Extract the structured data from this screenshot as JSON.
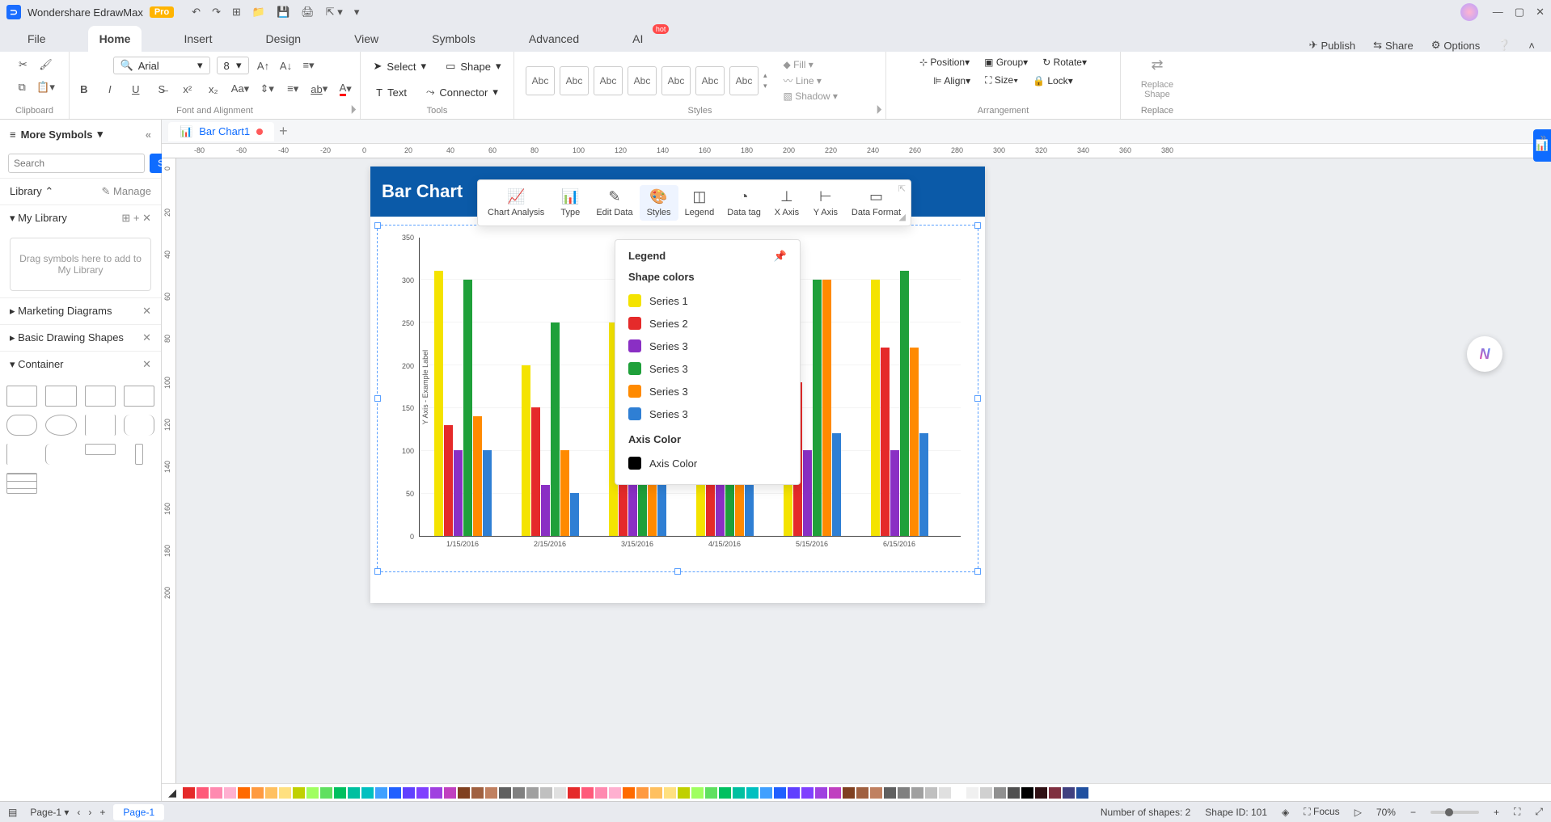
{
  "app": {
    "name": "Wondershare EdrawMax",
    "pro": "Pro"
  },
  "menu": {
    "tabs": [
      "File",
      "Home",
      "Insert",
      "Design",
      "View",
      "Symbols",
      "Advanced",
      "AI"
    ],
    "active": 1,
    "hot": "hot",
    "right": {
      "publish": "Publish",
      "share": "Share",
      "options": "Options"
    }
  },
  "ribbon": {
    "clipboard": "Clipboard",
    "font": {
      "label": "Font and Alignment",
      "name": "Arial",
      "size": "8"
    },
    "tools": {
      "label": "Tools",
      "select": "Select",
      "shape": "Shape",
      "text": "Text",
      "connector": "Connector"
    },
    "styles": {
      "label": "Styles",
      "abc": "Abc",
      "fill": "Fill",
      "line": "Line",
      "shadow": "Shadow"
    },
    "arrange": {
      "label": "Arrangement",
      "position": "Position",
      "align": "Align",
      "group": "Group",
      "size": "Size",
      "rotate": "Rotate",
      "lock": "Lock"
    },
    "replace": {
      "label": "Replace",
      "btn": "Replace Shape"
    }
  },
  "left": {
    "title": "More Symbols",
    "search_ph": "Search",
    "search_btn": "Search",
    "library": "Library",
    "manage": "Manage",
    "mylib": "My Library",
    "dropzone": "Drag symbols here to add to My Library",
    "cats": [
      "Marketing Diagrams",
      "Basic Drawing Shapes",
      "Container"
    ]
  },
  "doc": {
    "tab": "Bar Chart1"
  },
  "ruler_h": [
    "-80",
    "-60",
    "-40",
    "-20",
    "0",
    "20",
    "40",
    "60",
    "80",
    "100",
    "120",
    "140",
    "160",
    "180",
    "200",
    "220",
    "240",
    "260",
    "280",
    "300",
    "320",
    "340",
    "360",
    "380"
  ],
  "ruler_v": [
    "0",
    "20",
    "40",
    "60",
    "80",
    "100",
    "120",
    "140",
    "160",
    "180",
    "200"
  ],
  "chart_data": {
    "type": "bar",
    "title": "Bar Chart",
    "ylabel": "Y Axis - Example Label",
    "ylim": [
      0,
      350
    ],
    "yticks": [
      0,
      50,
      100,
      150,
      200,
      250,
      300,
      350
    ],
    "categories": [
      "1/15/2016",
      "2/15/2016",
      "3/15/2016",
      "4/15/2016",
      "5/15/2016",
      "6/15/2016"
    ],
    "series": [
      {
        "name": "Series 1",
        "color": "#f4e300",
        "values": [
          310,
          200,
          250,
          280,
          300,
          300
        ]
      },
      {
        "name": "Series 2",
        "color": "#e52a2a",
        "values": [
          130,
          150,
          180,
          200,
          180,
          220
        ]
      },
      {
        "name": "Series 3",
        "color": "#8a2fc4",
        "values": [
          100,
          60,
          90,
          150,
          100,
          100
        ]
      },
      {
        "name": "Series 3",
        "color": "#1fa03a",
        "values": [
          300,
          250,
          280,
          300,
          300,
          310
        ]
      },
      {
        "name": "Series 3",
        "color": "#ff8a00",
        "values": [
          140,
          100,
          160,
          340,
          300,
          220
        ]
      },
      {
        "name": "Series 3",
        "color": "#2f7fd4",
        "values": [
          100,
          50,
          70,
          80,
          120,
          120
        ]
      }
    ]
  },
  "float": {
    "items": [
      {
        "k": "chart-analysis",
        "l": "Chart Analysis"
      },
      {
        "k": "type",
        "l": "Type"
      },
      {
        "k": "edit-data",
        "l": "Edit Data"
      },
      {
        "k": "styles",
        "l": "Styles"
      },
      {
        "k": "legend",
        "l": "Legend"
      },
      {
        "k": "data-tag",
        "l": "Data tag"
      },
      {
        "k": "x-axis",
        "l": "X Axis"
      },
      {
        "k": "y-axis",
        "l": "Y Axis"
      },
      {
        "k": "data-format",
        "l": "Data Format"
      }
    ],
    "selected": 3
  },
  "legend_pop": {
    "title": "Legend",
    "shape_colors": "Shape colors",
    "axis_color_h": "Axis Color",
    "axis_color": "Axis Color"
  },
  "colorbar": [
    "#e52a2a",
    "#ff5a7a",
    "#ff8ab0",
    "#ffb0d0",
    "#ff6a00",
    "#ff9a40",
    "#ffc060",
    "#ffe080",
    "#c0d000",
    "#a0ff60",
    "#60e060",
    "#00c060",
    "#00c0a0",
    "#00c0c0",
    "#40a0ff",
    "#2060ff",
    "#6040ff",
    "#8040ff",
    "#a040e0",
    "#c040c0",
    "#804020",
    "#a06040",
    "#c08060",
    "#606060",
    "#808080",
    "#a0a0a0",
    "#c0c0c0",
    "#e0e0e0",
    "#e52a2a",
    "#ff5a7a",
    "#ff8ab0",
    "#ffb0d0",
    "#ff6a00",
    "#ff9a40",
    "#ffc060",
    "#ffe080",
    "#c0d000",
    "#a0ff60",
    "#60e060",
    "#00c060",
    "#00c0a0",
    "#00c0c0",
    "#40a0ff",
    "#2060ff",
    "#6040ff",
    "#8040ff",
    "#a040e0",
    "#c040c0",
    "#804020",
    "#a06040",
    "#c08060",
    "#606060",
    "#808080",
    "#a0a0a0",
    "#c0c0c0",
    "#e0e0e0",
    "#ffffff",
    "#f0f0f0",
    "#d0d0d0",
    "#909090",
    "#505050",
    "#000000",
    "#301014",
    "#803040",
    "#404080",
    "#2050a0"
  ],
  "status": {
    "page_sel": "Page-1",
    "page_tab": "Page-1",
    "shapes": "Number of shapes: 2",
    "shape_id": "Shape ID: 101",
    "focus": "Focus",
    "zoom": "70%"
  }
}
